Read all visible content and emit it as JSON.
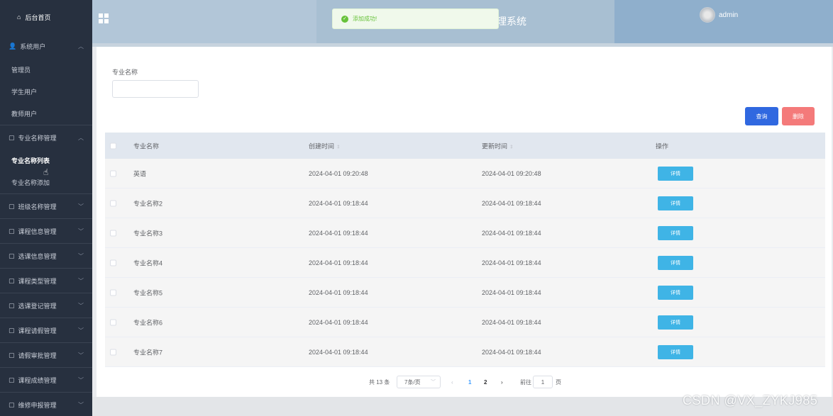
{
  "sidebar": {
    "home": "后台首页",
    "groups": [
      {
        "label": "系统用户",
        "expanded": true,
        "children": [
          "管理员",
          "学生用户",
          "教师用户"
        ]
      },
      {
        "label": "专业名称管理",
        "expanded": true,
        "children": [
          "专业名称列表",
          "专业名称添加"
        ],
        "active_child": "专业名称列表"
      },
      {
        "label": "班级名称管理"
      },
      {
        "label": "课程信息管理"
      },
      {
        "label": "选课信息管理"
      },
      {
        "label": "课程类型管理"
      },
      {
        "label": "选课登记管理"
      },
      {
        "label": "课程请假管理"
      },
      {
        "label": "请假审批管理"
      },
      {
        "label": "课程成绩管理"
      },
      {
        "label": "维修申报管理"
      }
    ]
  },
  "header": {
    "title_fragment": "理系统",
    "user": "admin"
  },
  "toast": {
    "message": "添加成功!",
    "type": "success",
    "color": "#67c23a"
  },
  "search": {
    "label": "专业名称",
    "value": ""
  },
  "toolbar": {
    "query_label": "查询",
    "delete_label": "删除",
    "query_color": "#3068e0",
    "delete_color": "#f47a7a"
  },
  "table": {
    "columns": [
      "专业名称",
      "创建时间",
      "更新时间",
      "操作"
    ],
    "rows": [
      {
        "name": "英语",
        "created": "2024-04-01 09:20:48",
        "updated": "2024-04-01 09:20:48",
        "action": "详情"
      },
      {
        "name": "专业名称2",
        "created": "2024-04-01 09:18:44",
        "updated": "2024-04-01 09:18:44",
        "action": "详情"
      },
      {
        "name": "专业名称3",
        "created": "2024-04-01 09:18:44",
        "updated": "2024-04-01 09:18:44",
        "action": "详情"
      },
      {
        "name": "专业名称4",
        "created": "2024-04-01 09:18:44",
        "updated": "2024-04-01 09:18:44",
        "action": "详情"
      },
      {
        "name": "专业名称5",
        "created": "2024-04-01 09:18:44",
        "updated": "2024-04-01 09:18:44",
        "action": "详情"
      },
      {
        "name": "专业名称6",
        "created": "2024-04-01 09:18:44",
        "updated": "2024-04-01 09:18:44",
        "action": "详情"
      },
      {
        "name": "专业名称7",
        "created": "2024-04-01 09:18:44",
        "updated": "2024-04-01 09:18:44",
        "action": "详情"
      }
    ]
  },
  "pagination": {
    "total": "共 13 条",
    "page_size": "7条/页",
    "pages": [
      "1",
      "2"
    ],
    "current_page": "1",
    "goto_label": "前往",
    "goto_value": "1",
    "page_suffix": "页"
  },
  "watermark": "CSDN @VX_ZYKJ985"
}
